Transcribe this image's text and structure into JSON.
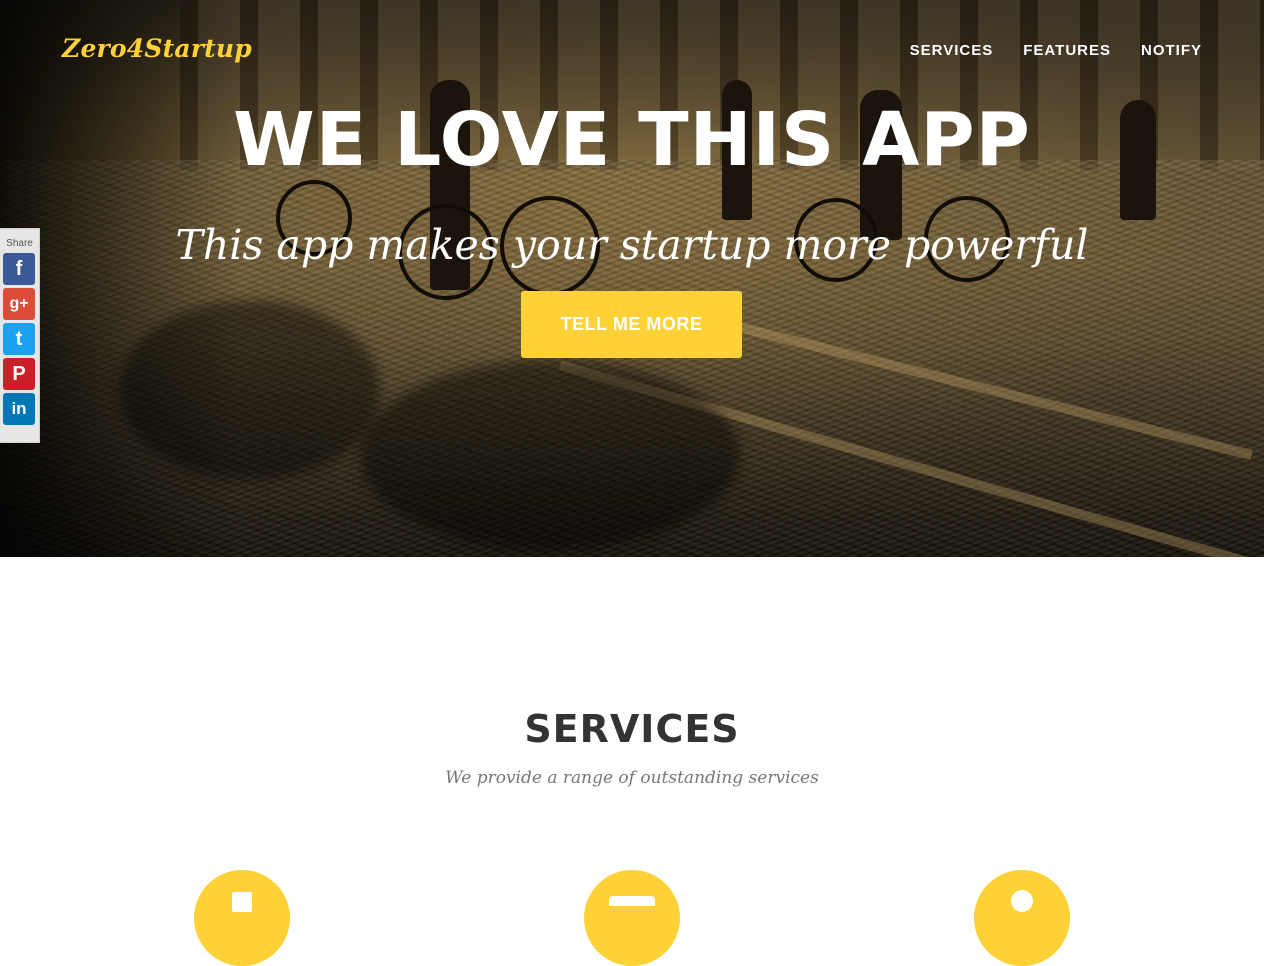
{
  "brand": "Zero4Startup",
  "nav": {
    "items": [
      {
        "label": "SERVICES"
      },
      {
        "label": "FEATURES"
      },
      {
        "label": "NOTIFY"
      }
    ]
  },
  "hero": {
    "title": "WE LOVE THIS APP",
    "subtitle": "This app makes your startup more powerful",
    "cta_label": "TELL ME MORE"
  },
  "share": {
    "label": "Share",
    "buttons": [
      {
        "name": "facebook",
        "glyph": "f",
        "color": "#3b5998"
      },
      {
        "name": "google-plus",
        "glyph": "g+",
        "color": "#dd4b39"
      },
      {
        "name": "twitter",
        "glyph": "t",
        "color": "#1da1f2"
      },
      {
        "name": "pinterest",
        "glyph": "P",
        "color": "#cb2027"
      },
      {
        "name": "linkedin",
        "glyph": "in",
        "color": "#0077b5"
      }
    ]
  },
  "services": {
    "title": "SERVICES",
    "subtitle": "We provide a range of outstanding services",
    "icons": [
      "shopping-cart-icon",
      "laptop-icon",
      "lock-icon"
    ]
  },
  "colors": {
    "accent": "#fed136",
    "heading": "#333333",
    "muted": "#777777"
  }
}
